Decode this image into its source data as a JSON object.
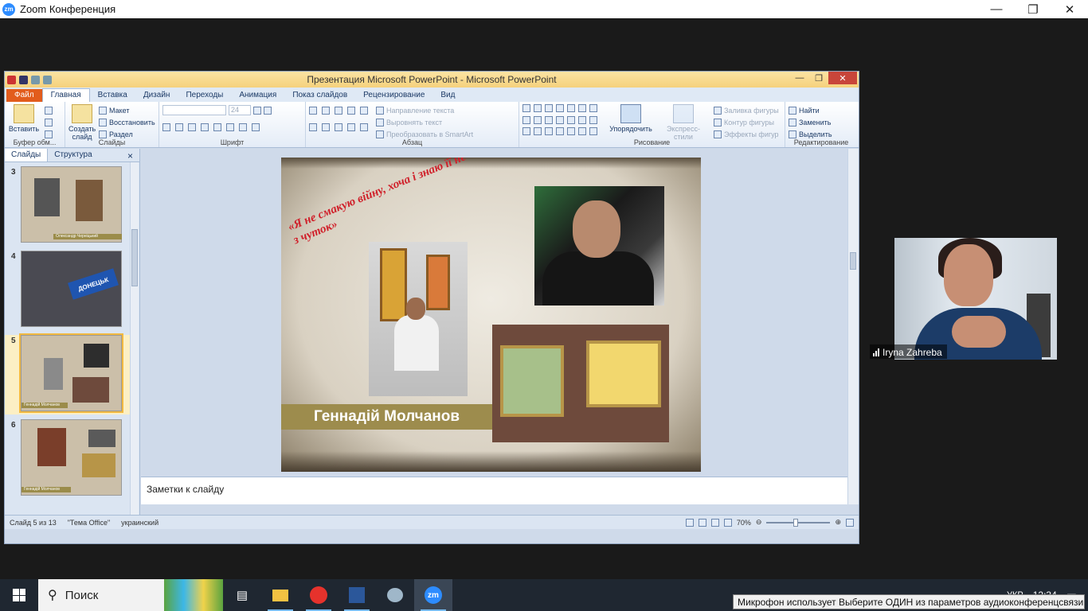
{
  "zoom": {
    "title": "Zoom Конференция",
    "logo": "zm"
  },
  "window_controls": {
    "minimize": "—",
    "maximize": "❐",
    "close": "✕"
  },
  "ppt": {
    "title": "Презентация Microsoft PowerPoint  -  Microsoft PowerPoint",
    "tabs": [
      "Файл",
      "Главная",
      "Вставка",
      "Дизайн",
      "Переходы",
      "Анимация",
      "Показ слайдов",
      "Рецензирование",
      "Вид"
    ],
    "ribbon": {
      "clipboard": {
        "paste": "Вставить",
        "label": "Буфер обм..."
      },
      "slides": {
        "create": "Создать слайд",
        "layout": "Макет",
        "reset": "Восстановить",
        "section": "Раздел",
        "label": "Слайды"
      },
      "font": {
        "size": "24",
        "label": "Шрифт"
      },
      "paragraph": {
        "direction": "Направление текста",
        "align": "Выровнять текст",
        "smartart": "Преобразовать в SmartArt",
        "label": "Абзац"
      },
      "drawing": {
        "arrange": "Упорядочить",
        "styles": "Экспресс-стили",
        "fill": "Заливка фигуры",
        "outline": "Контур фигуры",
        "effects": "Эффекты фигур",
        "label": "Рисование"
      },
      "editing": {
        "find": "Найти",
        "replace": "Заменить",
        "select": "Выделить",
        "label": "Редактирование"
      }
    },
    "side_tabs": {
      "slides": "Слайды",
      "outline": "Структура",
      "close": "×"
    },
    "thumbnails": [
      {
        "num": "3",
        "caption": "Олександр Черніцький"
      },
      {
        "num": "4",
        "caption": ""
      },
      {
        "num": "5",
        "caption": "Геннадій Молчанов"
      },
      {
        "num": "6",
        "caption": "Геннадій Молчанов"
      }
    ],
    "thumb_sign": "ДОНЕЦЬК",
    "slide": {
      "quote": "«Я не смакую війну, хоча і знаю її не з чуток»",
      "name": "Геннадій Молчанов"
    },
    "notes_placeholder": "Заметки к слайду",
    "status": {
      "slide": "Слайд 5 из 13",
      "theme": "\"Тема Office\"",
      "lang": "украинский",
      "zoom": "70%"
    }
  },
  "participant": {
    "name": "Iryna Zahreba"
  },
  "taskbar": {
    "search": "Поиск",
    "lang": "УКР",
    "time": "12:34"
  },
  "toast": "Микрофон использует Выберите ОДИН из параметров аудиоконференцсвязи"
}
